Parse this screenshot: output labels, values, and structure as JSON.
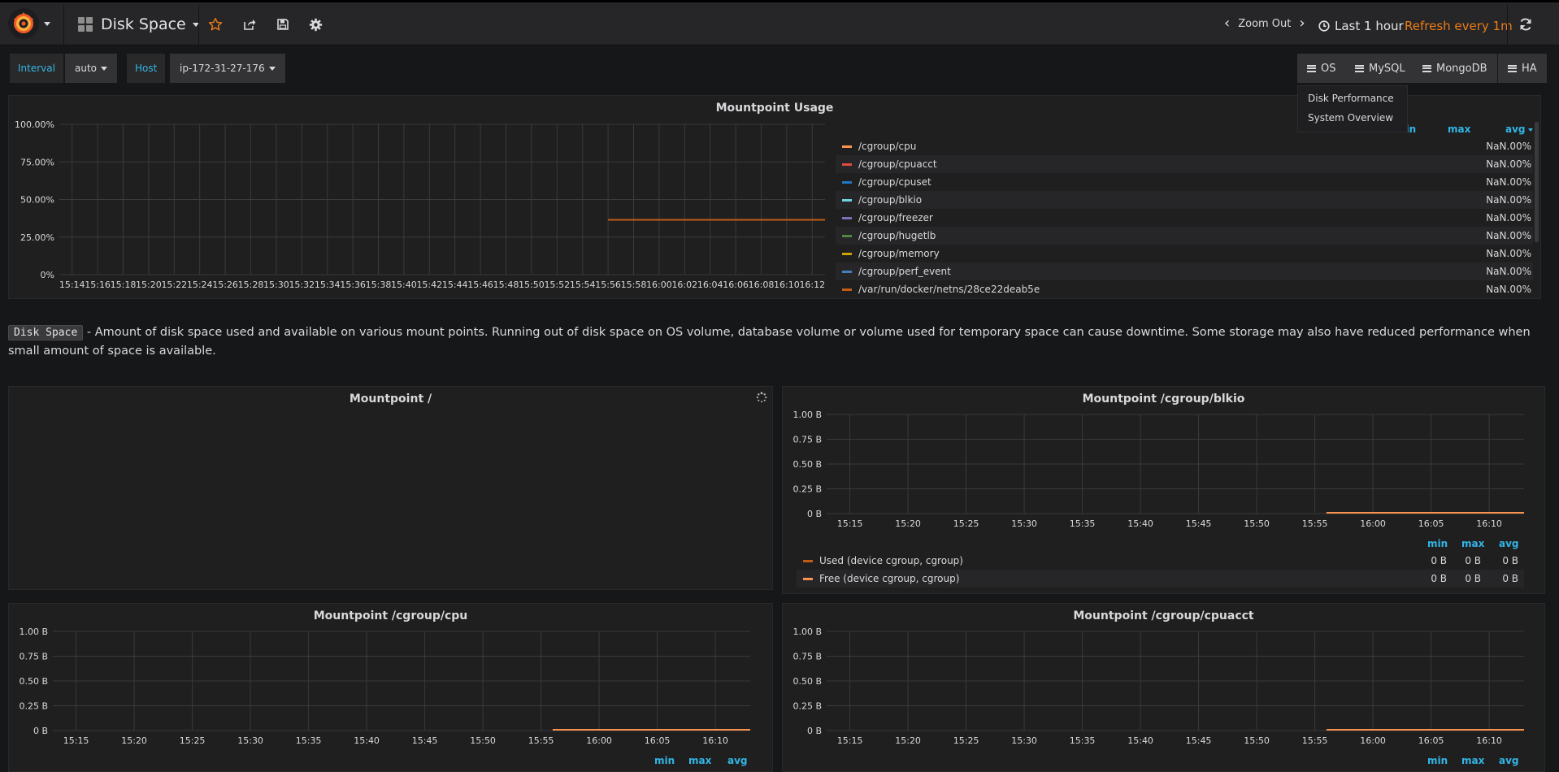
{
  "nav": {
    "dashboard_title": "Disk Space",
    "zoom_out": "Zoom Out",
    "time_range": "Last 1 hour",
    "refresh": "Refresh every 1m"
  },
  "variables": {
    "interval_label": "Interval",
    "interval_value": "auto",
    "host_label": "Host",
    "host_value": "ip-172-31-27-176"
  },
  "links": {
    "os": "OS",
    "mysql": "MySQL",
    "mongodb": "MongoDB",
    "ha": "HA",
    "os_menu": [
      "Disk Performance",
      "System Overview"
    ]
  },
  "usage_panel": {
    "title": "Mountpoint Usage",
    "legend_headers": {
      "min": "min",
      "max": "max",
      "avg": "avg"
    },
    "series": [
      {
        "name": "/cgroup/cpu",
        "color": "#f9934e",
        "avg": "NaN.00%"
      },
      {
        "name": "/cgroup/cpuacct",
        "color": "#e24d42",
        "avg": "NaN.00%"
      },
      {
        "name": "/cgroup/cpuset",
        "color": "#1f78c1",
        "avg": "NaN.00%"
      },
      {
        "name": "/cgroup/blkio",
        "color": "#6ed0e0",
        "avg": "NaN.00%"
      },
      {
        "name": "/cgroup/freezer",
        "color": "#806eb7",
        "avg": "NaN.00%"
      },
      {
        "name": "/cgroup/hugetlb",
        "color": "#508642",
        "avg": "NaN.00%"
      },
      {
        "name": "/cgroup/memory",
        "color": "#cca300",
        "avg": "NaN.00%"
      },
      {
        "name": "/cgroup/perf_event",
        "color": "#447ebc",
        "avg": "NaN.00%"
      },
      {
        "name": "/var/run/docker/netns/28ce22deab5e",
        "color": "#c15c17",
        "avg": "NaN.00%"
      }
    ]
  },
  "text_panel": {
    "code": "Disk Space",
    "body": " - Amount of disk space used and available on various mount points. Running out of disk space on OS volume, database volume or volume used for temporary space can cause downtime. Some storage may also have reduced performance when small amount of space is available."
  },
  "panels": {
    "root": {
      "title": "Mountpoint /"
    },
    "blkio": {
      "title": "Mountpoint /cgroup/blkio",
      "legend_headers": {
        "min": "min",
        "max": "max",
        "avg": "avg"
      },
      "series": [
        {
          "name": "Used (device cgroup, cgroup)",
          "color": "#c15c17",
          "min": "0 B",
          "max": "0 B",
          "avg": "0 B"
        },
        {
          "name": "Free (device cgroup, cgroup)",
          "color": "#f9934e",
          "min": "0 B",
          "max": "0 B",
          "avg": "0 B"
        }
      ]
    },
    "cpu": {
      "title": "Mountpoint /cgroup/cpu",
      "legend_headers": {
        "min": "min",
        "max": "max",
        "avg": "avg"
      }
    },
    "cpuacct": {
      "title": "Mountpoint /cgroup/cpuacct",
      "legend_headers": {
        "min": "min",
        "max": "max",
        "avg": "avg"
      }
    }
  },
  "chart_data": [
    {
      "type": "line",
      "title": "Mountpoint Usage",
      "y_ticks": [
        "100.00%",
        "75.00%",
        "50.00%",
        "25.00%",
        "0%"
      ],
      "ylim": [
        0,
        100
      ],
      "x_ticks": [
        "15:14",
        "15:16",
        "15:18",
        "15:20",
        "15:22",
        "15:24",
        "15:26",
        "15:28",
        "15:30",
        "15:32",
        "15:34",
        "15:36",
        "15:38",
        "15:40",
        "15:42",
        "15:44",
        "15:46",
        "15:48",
        "15:50",
        "15:52",
        "15:54",
        "15:56",
        "15:58",
        "16:00",
        "16:02",
        "16:04",
        "16:06",
        "16:08",
        "16:10",
        "16:12"
      ],
      "series": [
        {
          "name": "/var/run/docker/netns/28ce22deab5e",
          "color": "#c15c17",
          "x": [
            "15:56",
            "16:13"
          ],
          "y": [
            36.5,
            36.5
          ]
        }
      ]
    },
    {
      "type": "line",
      "title": "Mountpoint /cgroup/blkio",
      "y_ticks": [
        "1.00 B",
        "0.75 B",
        "0.50 B",
        "0.25 B",
        "0 B"
      ],
      "x_ticks": [
        "15:15",
        "15:20",
        "15:25",
        "15:30",
        "15:35",
        "15:40",
        "15:45",
        "15:50",
        "15:55",
        "16:00",
        "16:05",
        "16:10"
      ],
      "series": [
        {
          "name": "Free (device cgroup, cgroup)",
          "color": "#f9934e",
          "x": [
            "15:56",
            "16:13"
          ],
          "y": [
            0,
            0
          ]
        }
      ]
    },
    {
      "type": "line",
      "title": "Mountpoint /cgroup/cpu",
      "y_ticks": [
        "1.00 B",
        "0.75 B",
        "0.50 B",
        "0.25 B",
        "0 B"
      ],
      "x_ticks": [
        "15:15",
        "15:20",
        "15:25",
        "15:30",
        "15:35",
        "15:40",
        "15:45",
        "15:50",
        "15:55",
        "16:00",
        "16:05",
        "16:10"
      ],
      "series": [
        {
          "color": "#f9934e",
          "x": [
            "15:56",
            "16:13"
          ],
          "y": [
            0,
            0
          ]
        }
      ]
    },
    {
      "type": "line",
      "title": "Mountpoint /cgroup/cpuacct",
      "y_ticks": [
        "1.00 B",
        "0.75 B",
        "0.50 B",
        "0.25 B",
        "0 B"
      ],
      "x_ticks": [
        "15:15",
        "15:20",
        "15:25",
        "15:30",
        "15:35",
        "15:40",
        "15:45",
        "15:50",
        "15:55",
        "16:00",
        "16:05",
        "16:10"
      ],
      "series": [
        {
          "color": "#f9934e",
          "x": [
            "15:56",
            "16:13"
          ],
          "y": [
            0,
            0
          ]
        }
      ]
    }
  ]
}
